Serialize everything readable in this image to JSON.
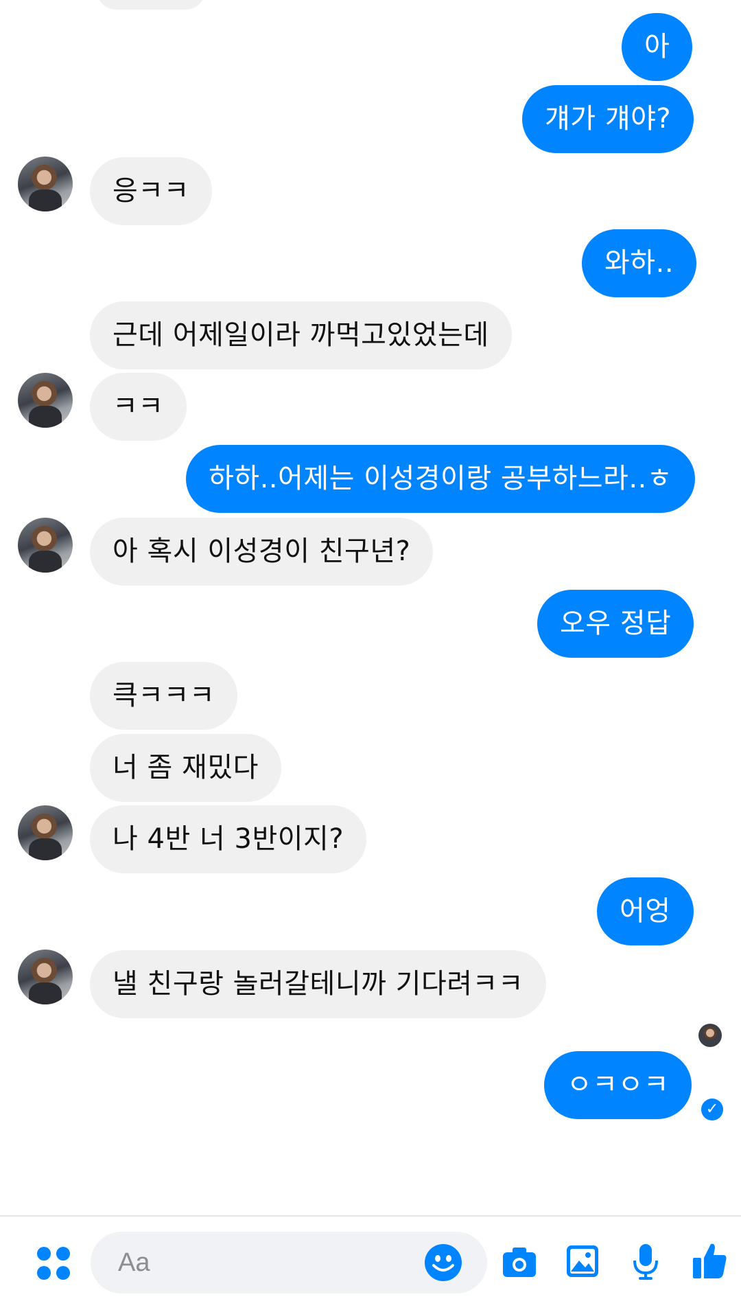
{
  "conversation": {
    "messages": [
      {
        "text": "아",
        "direction": "out"
      },
      {
        "text": "걔가 걔야?",
        "direction": "out"
      },
      {
        "text": "응ㅋㅋ",
        "direction": "in"
      },
      {
        "text": "와하..",
        "direction": "out"
      },
      {
        "text": "근데 어제일이라 까먹고있었는데",
        "direction": "in"
      },
      {
        "text": "ㅋㅋ",
        "direction": "in"
      },
      {
        "text": "하하..어제는 이성경이랑 공부하느라..ㅎ",
        "direction": "out"
      },
      {
        "text": "아 혹시 이성경이 친구년?",
        "direction": "in"
      },
      {
        "text": "오우 정답",
        "direction": "out"
      },
      {
        "text": "큭ㅋㅋㅋ",
        "direction": "in"
      },
      {
        "text": "너 좀 재밌다",
        "direction": "in"
      },
      {
        "text": "나 4반 너 3반이지?",
        "direction": "in"
      },
      {
        "text": "어엉",
        "direction": "out"
      },
      {
        "text": "낼 친구랑 놀러갈테니까 기다려ㅋㅋ",
        "direction": "in"
      },
      {
        "text": "ㅇㅋㅇㅋ",
        "direction": "out"
      }
    ],
    "read_receipt_icon": "check-circle-icon"
  },
  "composer": {
    "placeholder": "Aa",
    "icons": [
      "apps-icon",
      "emoji-icon",
      "camera-icon",
      "image-icon",
      "microphone-icon",
      "thumbs-up-icon"
    ]
  },
  "colors": {
    "outgoing_bubble": "#0084ff",
    "incoming_bubble": "#f1f0f0",
    "accent": "#0084ff"
  }
}
